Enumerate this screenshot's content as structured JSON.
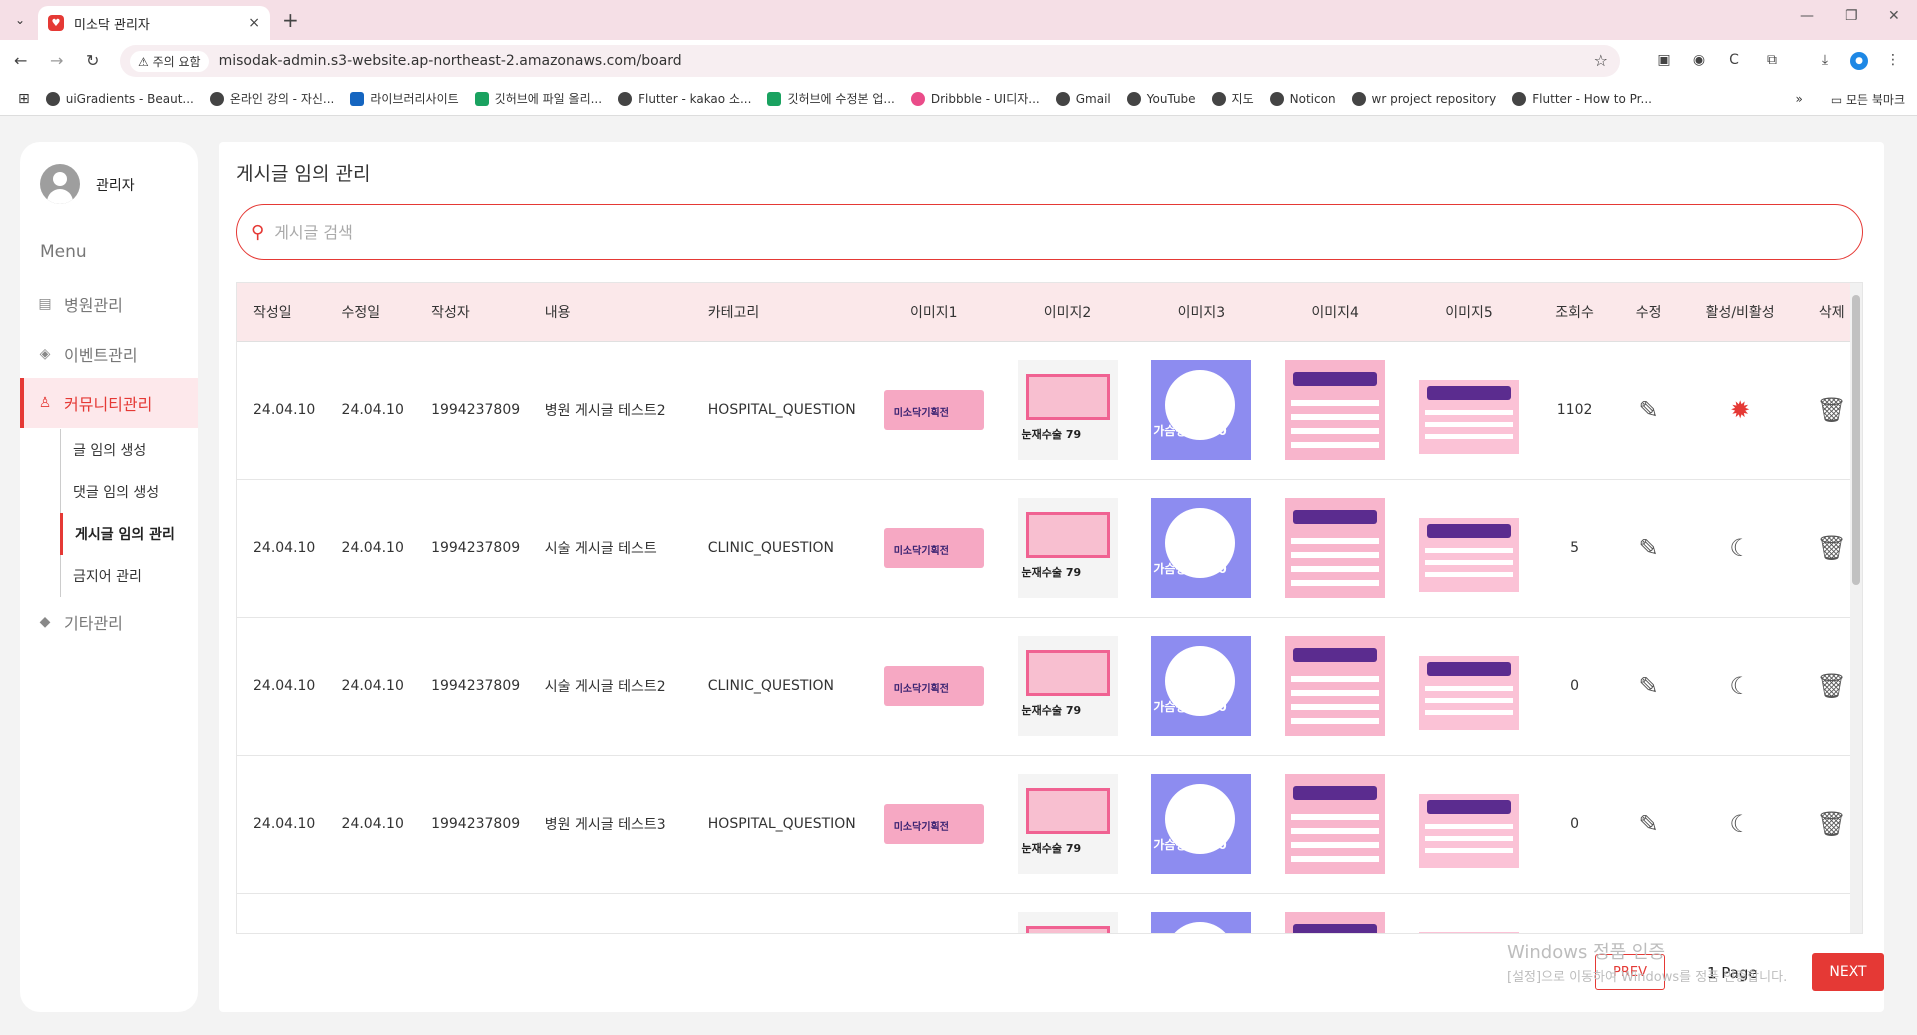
{
  "browser": {
    "tab_title": "미소닥 관리자",
    "tab_close": "×",
    "new_tab": "+",
    "security_chip": "주의 요함",
    "url": "misodak-admin.s3-website.ap-northeast-2.amazonaws.com/board",
    "bookmarks": [
      "uiGradients - Beaut...",
      "온라인 강의 - 자신...",
      "라이브러리사이트",
      "깃허브에 파일 올리...",
      "Flutter - kakao 소...",
      "깃허브에 수정본 업...",
      "Dribbble - UI디자...",
      "Gmail",
      "YouTube",
      "지도",
      "Noticon",
      "wr project repository",
      "Flutter - How to Pr..."
    ],
    "all_bookmarks": "모든 북마크"
  },
  "sidebar": {
    "user_name": "관리자",
    "menu_title": "Menu",
    "items": [
      {
        "label": "병원관리"
      },
      {
        "label": "이벤트관리"
      },
      {
        "label": "커뮤니티관리"
      },
      {
        "label": "기타관리"
      }
    ],
    "sub_items": [
      {
        "label": "글 임의 생성"
      },
      {
        "label": "댓글 임의 생성"
      },
      {
        "label": "게시글 임의 관리"
      },
      {
        "label": "금지어 관리"
      }
    ]
  },
  "main": {
    "title": "게시글 임의 관리",
    "search_placeholder": "게시글 검색",
    "columns": [
      "작성일",
      "수정일",
      "작성자",
      "내용",
      "카테고리",
      "이미지1",
      "이미지2",
      "이미지3",
      "이미지4",
      "이미지5",
      "조회수",
      "수정",
      "활성/비활성",
      "삭제"
    ],
    "rows": [
      {
        "created": "24.04.10",
        "modified": "24.04.10",
        "author": "1994237809",
        "content": "병원 게시글 테스트2",
        "category": "HOSPITAL_QUESTION",
        "views": "1102",
        "active": true
      },
      {
        "created": "24.04.10",
        "modified": "24.04.10",
        "author": "1994237809",
        "content": "시술 게시글 테스트",
        "category": "CLINIC_QUESTION",
        "views": "5",
        "active": false
      },
      {
        "created": "24.04.10",
        "modified": "24.04.10",
        "author": "1994237809",
        "content": "시술 게시글 테스트2",
        "category": "CLINIC_QUESTION",
        "views": "0",
        "active": false
      },
      {
        "created": "24.04.10",
        "modified": "24.04.10",
        "author": "1994237809",
        "content": "병원 게시글 테스트3",
        "category": "HOSPITAL_QUESTION",
        "views": "0",
        "active": false
      }
    ],
    "image_labels": {
      "img1": "미소닥기획전",
      "img2": "눈재수술 79",
      "img3": "가슴성형 450"
    },
    "pager": {
      "prev": "PREV",
      "page": "1 Page",
      "next": "NEXT"
    }
  },
  "watermark": {
    "line1": "Windows 정품 인증",
    "line2": "[설정]으로 이동하여 Windows를 정품 인증합니다."
  },
  "colors": {
    "accent": "#e53935",
    "header_bg": "#fbe8ea",
    "tab_strip": "#f5dfe6"
  }
}
